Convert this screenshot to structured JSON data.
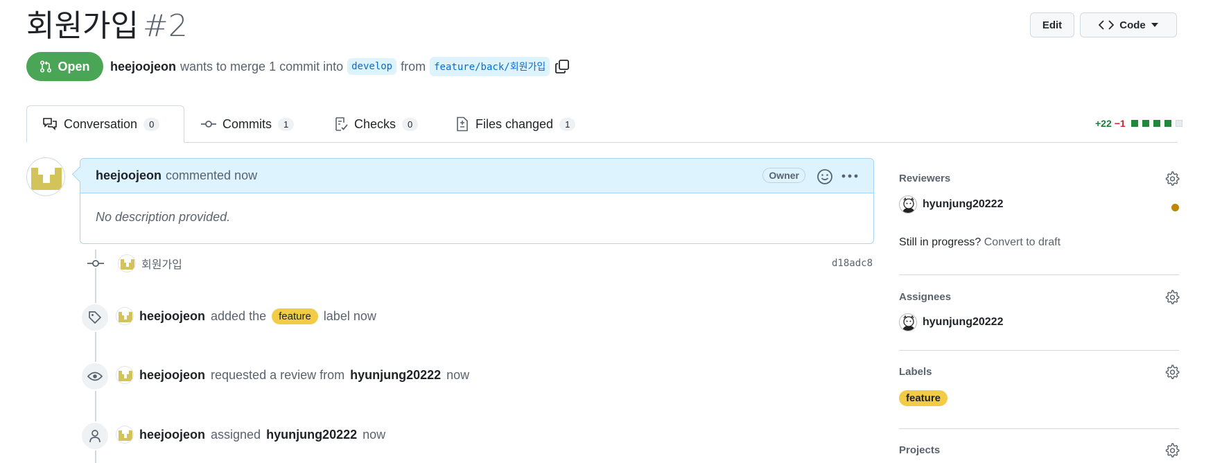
{
  "pr": {
    "title": "회원가입",
    "number": "#2",
    "state": "Open",
    "author": "heejoojeon",
    "merge_text": "wants to merge 1 commit into",
    "base_branch": "develop",
    "from_text": "from",
    "head_branch": "feature/back/회원가입"
  },
  "header_buttons": {
    "edit": "Edit",
    "code": "Code"
  },
  "tabs": [
    {
      "label": "Conversation",
      "count": "0"
    },
    {
      "label": "Commits",
      "count": "1"
    },
    {
      "label": "Checks",
      "count": "0"
    },
    {
      "label": "Files changed",
      "count": "1"
    }
  ],
  "diffstat": {
    "additions": "+22",
    "deletions": "−1"
  },
  "comment": {
    "author": "heejoojeon",
    "action": "commented now",
    "role": "Owner",
    "body": "No description provided."
  },
  "timeline": {
    "commit": {
      "message": "회원가입",
      "sha": "d18adc8"
    },
    "label_event": {
      "actor": "heejoojeon",
      "pre": "added the",
      "label": "feature",
      "post": "label now"
    },
    "review_event": {
      "actor": "heejoojeon",
      "pre": "requested a review from",
      "target": "hyunjung20222",
      "post": "now"
    },
    "assign_event": {
      "actor": "heejoojeon",
      "pre": "assigned",
      "target": "hyunjung20222",
      "post": "now"
    }
  },
  "sidebar": {
    "reviewers": {
      "title": "Reviewers",
      "user": "hyunjung20222",
      "draft_prefix": "Still in progress?",
      "draft_link": "Convert to draft"
    },
    "assignees": {
      "title": "Assignees",
      "user": "hyunjung20222"
    },
    "labels": {
      "title": "Labels",
      "label": "feature"
    },
    "projects": {
      "title": "Projects"
    }
  },
  "colors": {
    "open_green": "#4aa656",
    "label_yellow": "#f2cc47",
    "pending_dot": "#bf8700"
  }
}
